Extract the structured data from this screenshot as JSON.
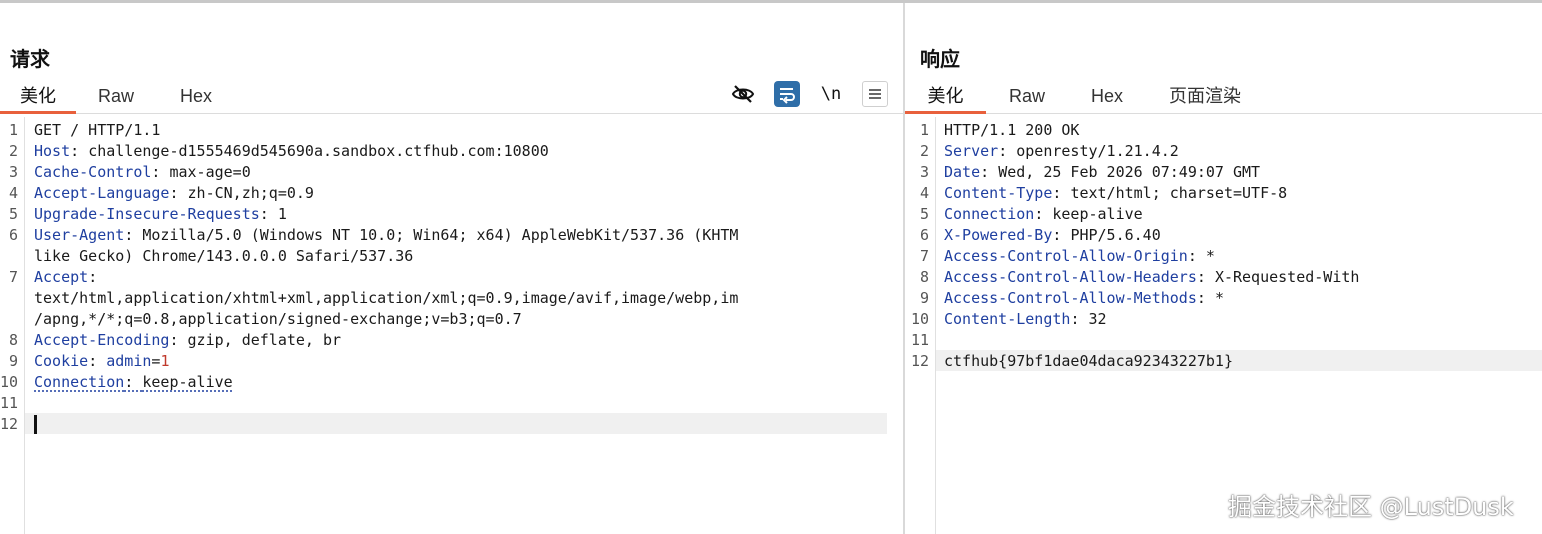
{
  "request": {
    "title": "请求",
    "tabs": [
      "美化",
      "Raw",
      "Hex"
    ],
    "lines": [
      {
        "n": "1",
        "text": "GET / HTTP/1.1"
      },
      {
        "n": "2",
        "key": "Host",
        "sep": ": ",
        "value": "challenge-d1555469d545690a.sandbox.ctfhub.com:10800"
      },
      {
        "n": "3",
        "key": "Cache-Control",
        "sep": ": ",
        "value": "max-age=0"
      },
      {
        "n": "4",
        "key": "Accept-Language",
        "sep": ": ",
        "value": "zh-CN,zh;q=0.9"
      },
      {
        "n": "5",
        "key": "Upgrade-Insecure-Requests",
        "sep": ": ",
        "value": "1"
      },
      {
        "n": "6",
        "key": "User-Agent",
        "sep": ": ",
        "value": "Mozilla/5.0 (Windows NT 10.0; Win64; x64) AppleWebKit/537.36 (KHTM"
      },
      {
        "n": "",
        "text": "like Gecko) Chrome/143.0.0.0 Safari/537.36"
      },
      {
        "n": "7",
        "key": "Accept",
        "sep": ":",
        "value": ""
      },
      {
        "n": "",
        "text": "text/html,application/xhtml+xml,application/xml;q=0.9,image/avif,image/webp,im"
      },
      {
        "n": "",
        "text": "/apng,*/*;q=0.8,application/signed-exchange;v=b3;q=0.7"
      },
      {
        "n": "8",
        "key": "Accept-Encoding",
        "sep": ": ",
        "value": "gzip, deflate, br"
      },
      {
        "n": "9",
        "key": "Cookie",
        "sep": ": ",
        "cookie_name": "admin",
        "cookie_eq": "=",
        "cookie_value": "1"
      },
      {
        "n": "10",
        "key": "Connection",
        "sep": ": ",
        "value": "keep-alive"
      },
      {
        "n": "11",
        "text": ""
      },
      {
        "n": "12",
        "text": ""
      }
    ]
  },
  "response": {
    "title": "响应",
    "tabs": [
      "美化",
      "Raw",
      "Hex",
      "页面渲染"
    ],
    "lines": [
      {
        "n": "1",
        "text": "HTTP/1.1 200 OK"
      },
      {
        "n": "2",
        "key": "Server",
        "sep": ": ",
        "value": "openresty/1.21.4.2"
      },
      {
        "n": "3",
        "key": "Date",
        "sep": ": ",
        "value": "Wed, 25 Feb 2026 07:49:07 GMT"
      },
      {
        "n": "4",
        "key": "Content-Type",
        "sep": ": ",
        "value": "text/html; charset=UTF-8"
      },
      {
        "n": "5",
        "key": "Connection",
        "sep": ": ",
        "value": "keep-alive"
      },
      {
        "n": "6",
        "key": "X-Powered-By",
        "sep": ": ",
        "value": "PHP/5.6.40"
      },
      {
        "n": "7",
        "key": "Access-Control-Allow-Origin",
        "sep": ": ",
        "value": "*"
      },
      {
        "n": "8",
        "key": "Access-Control-Allow-Headers",
        "sep": ": ",
        "value": "X-Requested-With"
      },
      {
        "n": "9",
        "key": "Access-Control-Allow-Methods",
        "sep": ": ",
        "value": "*"
      },
      {
        "n": "10",
        "key": "Content-Length",
        "sep": ": ",
        "value": "32"
      },
      {
        "n": "11",
        "text": ""
      },
      {
        "n": "12",
        "text": "ctfhub{97bf1dae04daca92343227b1}"
      }
    ]
  },
  "toolbar": {
    "newline_label": "\\n",
    "icons": [
      "eye-off-icon",
      "wrap-icon",
      "newline-icon",
      "menu-icon"
    ],
    "accent_color": "#2f6ea8"
  },
  "watermark": "掘金技术社区 @LustDusk"
}
